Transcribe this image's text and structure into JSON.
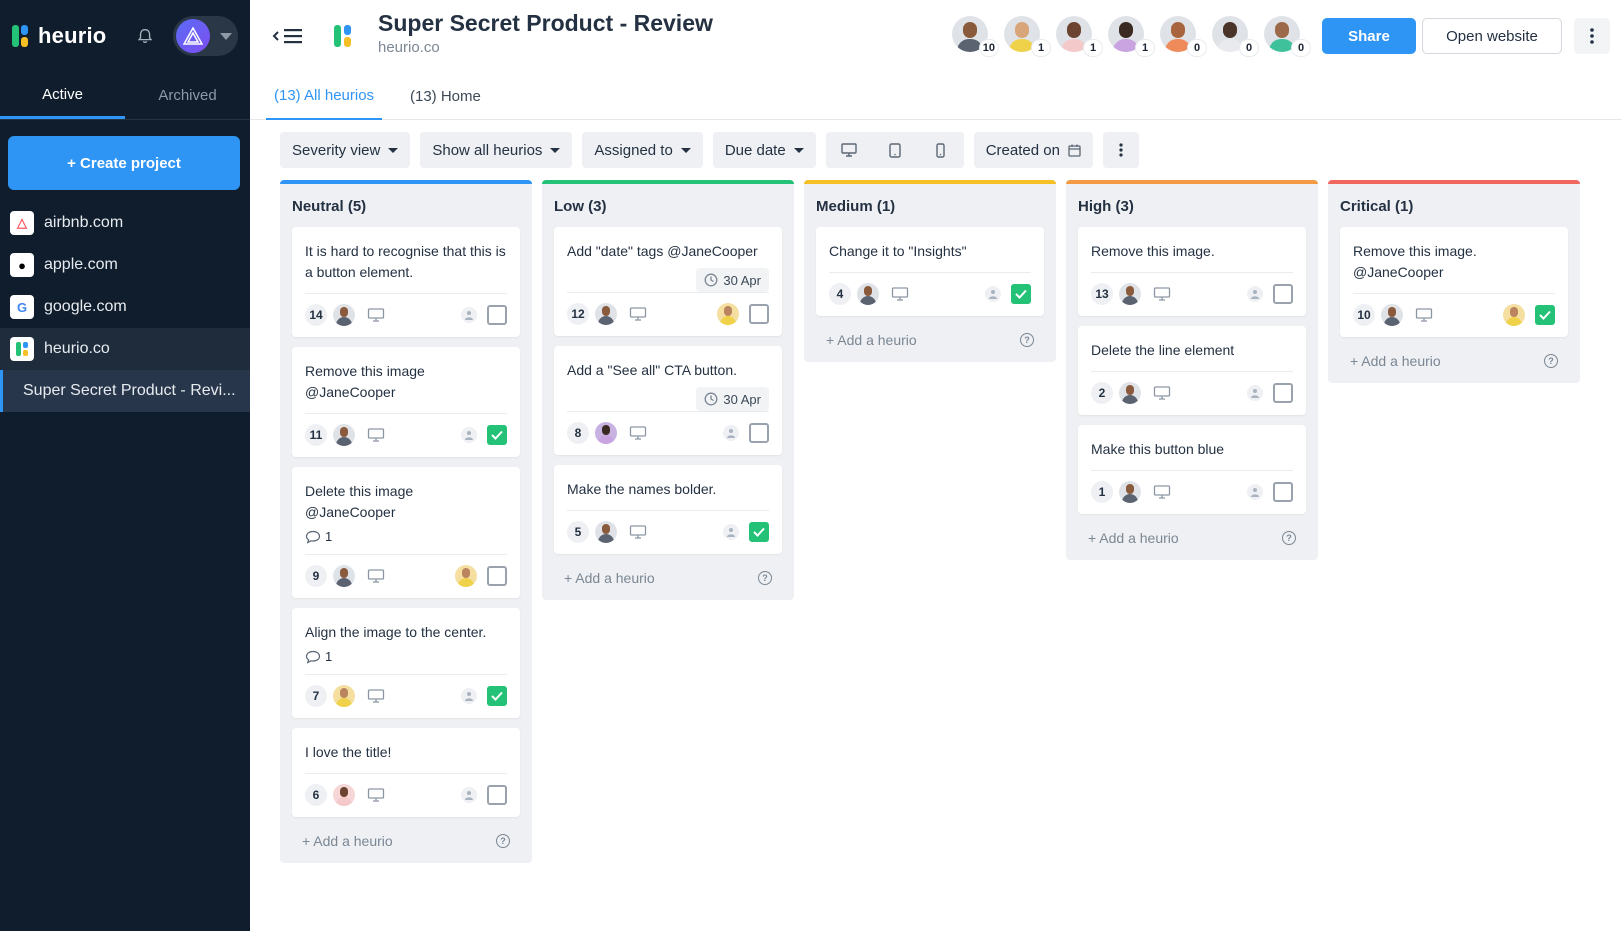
{
  "app": {
    "name": "heurio",
    "account_icon": "triangle-logo-icon"
  },
  "sidebar": {
    "tabs": [
      {
        "label": "Active"
      },
      {
        "label": "Archived"
      }
    ],
    "create_label": "+ Create project",
    "projects": [
      {
        "label": "airbnb.com",
        "icon": "airbnb-icon",
        "color": "#ff5a5f"
      },
      {
        "label": "apple.com",
        "icon": "apple-icon",
        "color": "#000000"
      },
      {
        "label": "google.com",
        "icon": "google-icon",
        "color": "#4285f4"
      },
      {
        "label": "heurio.co",
        "icon": "heurio-icon",
        "color": "#23c277"
      }
    ],
    "active_subproject": "Super Secret Product - Revi..."
  },
  "header": {
    "title": "Super Secret Product - Review",
    "subtitle": "heurio.co",
    "share_label": "Share",
    "open_label": "Open website",
    "collaborators": [
      {
        "count": "10",
        "skin": "#8a5a3c",
        "shirt": "#5b6270"
      },
      {
        "count": "1",
        "skin": "#d8a47a",
        "shirt": "#f0d24a"
      },
      {
        "count": "1",
        "skin": "#6b4330",
        "shirt": "#f3c9c9"
      },
      {
        "count": "1",
        "skin": "#3b2a22",
        "shirt": "#c9a4e0"
      },
      {
        "count": "0",
        "skin": "#a8643e",
        "shirt": "#ef8a5a"
      },
      {
        "count": "0",
        "skin": "#4a3328",
        "shirt": "#e8eaed"
      },
      {
        "count": "0",
        "skin": "#9c6a4a",
        "shirt": "#3fc19b"
      }
    ]
  },
  "tabs": [
    {
      "label": "(13) All heurios"
    },
    {
      "label": "(13) Home"
    }
  ],
  "toolbar": {
    "severity": "Severity view",
    "show": "Show all heurios",
    "assigned": "Assigned to",
    "due": "Due date",
    "created": "Created on"
  },
  "board": {
    "add_label": "+ Add a heurio",
    "columns": [
      {
        "title": "Neutral (5)",
        "color": "#2f95f4",
        "cards": [
          {
            "text": "It is hard to recognise that this is a button element.",
            "num": "14",
            "checked": false,
            "assignee": false
          },
          {
            "text": "Remove this image @JaneCooper",
            "num": "11",
            "checked": true,
            "assignee": false
          },
          {
            "text": "Delete this image @JaneCooper",
            "comments": "1",
            "num": "9",
            "checked": false,
            "assignee": true
          },
          {
            "text": "Align the image to the center.",
            "comments": "1",
            "num": "7",
            "checked": true,
            "assignee": false,
            "author_female": true
          },
          {
            "text": "I love the title!",
            "num": "6",
            "checked": false,
            "assignee": false,
            "author_pink": true
          }
        ]
      },
      {
        "title": "Low (3)",
        "color": "#23c277",
        "cards": [
          {
            "text": "Add \"date\" tags  @JaneCooper",
            "date": "30 Apr",
            "num": "12",
            "checked": false,
            "assignee": true
          },
          {
            "text": "Add a \"See all\" CTA button.",
            "date": "30 Apr",
            "num": "8",
            "checked": false,
            "assignee": false,
            "author_purple": true
          },
          {
            "text": "Make the names bolder.",
            "num": "5",
            "checked": true,
            "assignee": false
          }
        ]
      },
      {
        "title": "Medium (1)",
        "color": "#f5c026",
        "cards": [
          {
            "text": "Change it to \"Insights\"",
            "num": "4",
            "checked": true,
            "assignee": false
          }
        ]
      },
      {
        "title": "High (3)",
        "color": "#f39a45",
        "cards": [
          {
            "text": "Remove this image.",
            "num": "13",
            "checked": false,
            "assignee": false
          },
          {
            "text": "Delete the line element",
            "num": "2",
            "checked": false,
            "assignee": false
          },
          {
            "text": "Make this button blue",
            "num": "1",
            "checked": false,
            "assignee": false
          }
        ]
      },
      {
        "title": "Critical (1)",
        "color": "#f0675f",
        "cards": [
          {
            "text": "Remove this image. @JaneCooper",
            "num": "10",
            "checked": true,
            "assignee": true
          }
        ]
      }
    ]
  }
}
